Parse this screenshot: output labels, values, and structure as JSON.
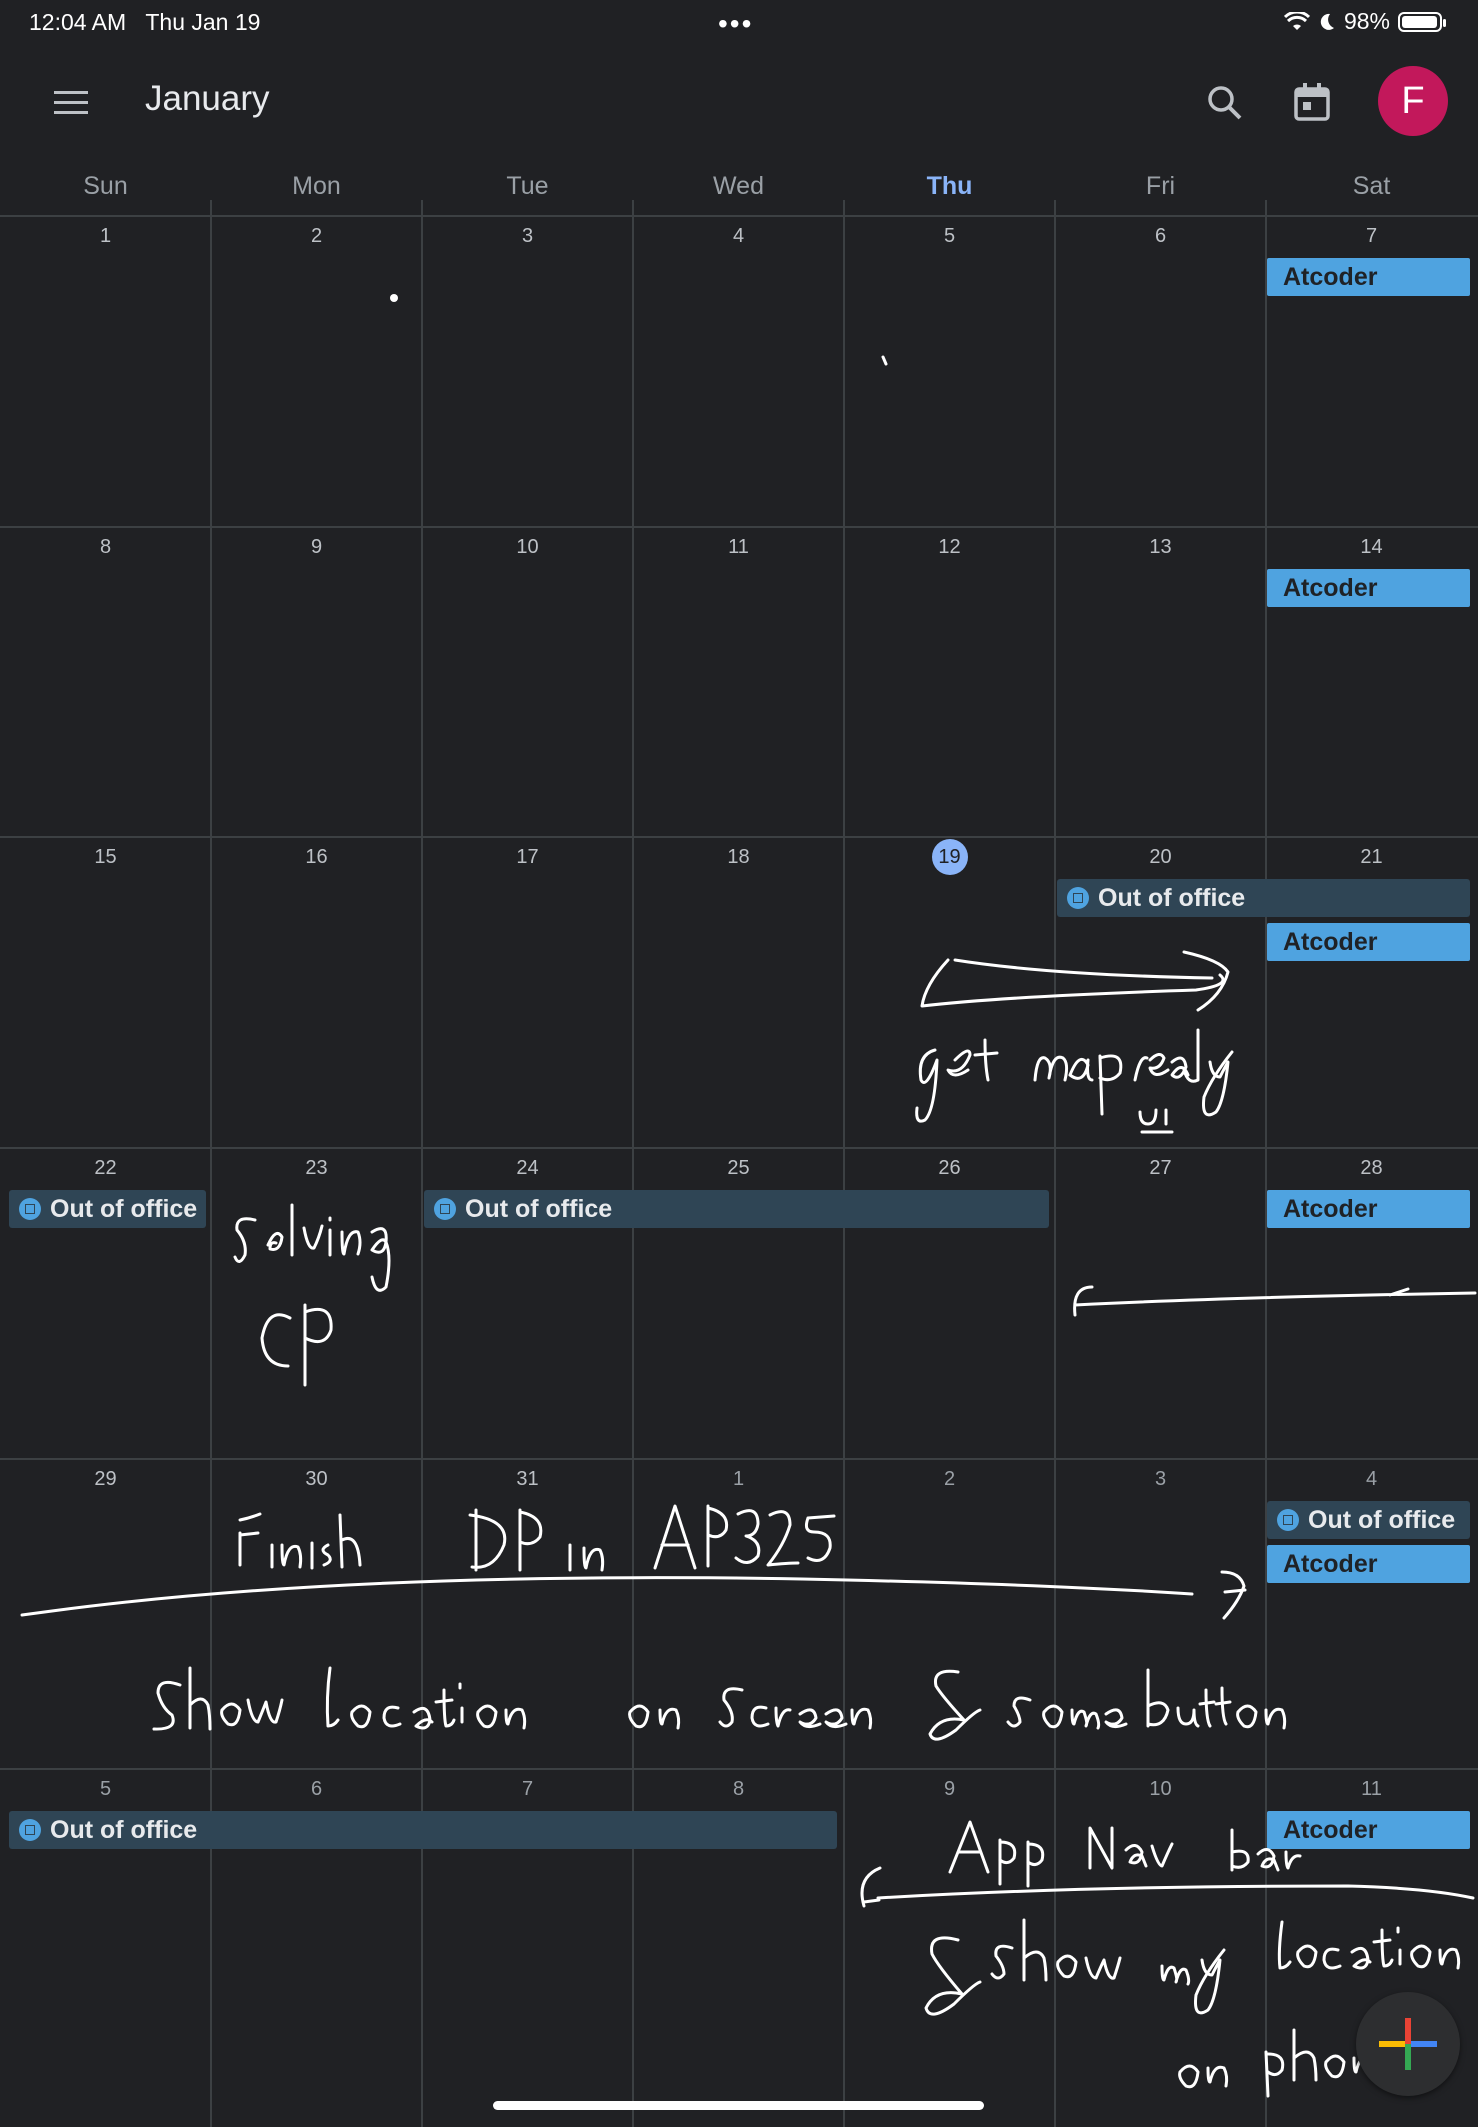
{
  "status_bar": {
    "time": "12:04 AM",
    "date": "Thu Jan 19",
    "battery": "98%",
    "battery_level": 0.98
  },
  "app_bar": {
    "title": "January",
    "avatar_letter": "F"
  },
  "weekdays": [
    "Sun",
    "Mon",
    "Tue",
    "Wed",
    "Thu",
    "Fri",
    "Sat"
  ],
  "today_weekday": "Thu",
  "weeks": [
    [
      "1",
      "2",
      "3",
      "4",
      "5",
      "6",
      "7"
    ],
    [
      "8",
      "9",
      "10",
      "11",
      "12",
      "13",
      "14"
    ],
    [
      "15",
      "16",
      "17",
      "18",
      "19",
      "20",
      "21"
    ],
    [
      "22",
      "23",
      "24",
      "25",
      "26",
      "27",
      "28"
    ],
    [
      "29",
      "30",
      "31",
      "1",
      "2",
      "3",
      "4"
    ],
    [
      "5",
      "6",
      "7",
      "8",
      "9",
      "10",
      "11"
    ]
  ],
  "today_date": "19",
  "events": {
    "atcoder": "Atcoder",
    "out_of_office": "Out of office"
  },
  "colors": {
    "background": "#202124",
    "atcoder": "#4fa3e0",
    "out_of_office": "#2f4555",
    "today": "#8ab4f8",
    "avatar": "#c2185b"
  },
  "icons": [
    "menu-icon",
    "search-icon",
    "today-icon",
    "add-icon",
    "out-of-office-icon"
  ]
}
